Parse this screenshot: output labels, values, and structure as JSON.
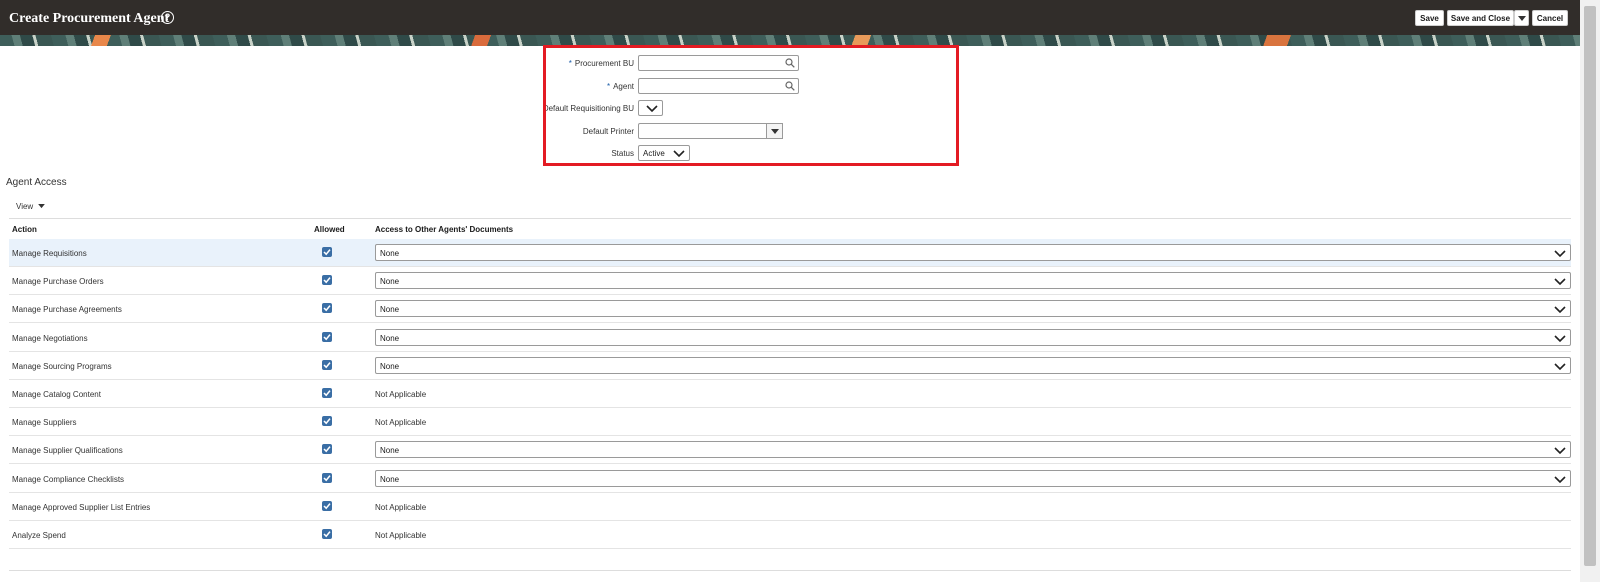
{
  "header": {
    "title": "Create Procurement Agent",
    "help_icon": "question-circle-icon",
    "buttons": {
      "save": "Save",
      "save_and_close": "Save and Close",
      "cancel": "Cancel"
    }
  },
  "form": {
    "procurement_bu": {
      "label": "Procurement BU",
      "required_marker": "*",
      "value": ""
    },
    "agent": {
      "label": "Agent",
      "required_marker": "*",
      "value": ""
    },
    "default_requisitioning_bu": {
      "label": "Default Requisitioning BU",
      "value": ""
    },
    "default_printer": {
      "label": "Default Printer",
      "value": ""
    },
    "status": {
      "label": "Status",
      "value": "Active"
    }
  },
  "agent_access": {
    "section_title": "Agent Access",
    "view_menu": "View",
    "columns": {
      "action": "Action",
      "allowed": "Allowed",
      "access": "Access to Other Agents' Documents"
    },
    "rows": [
      {
        "action": "Manage Requisitions",
        "allowed": true,
        "access": "None",
        "access_type": "select"
      },
      {
        "action": "Manage Purchase Orders",
        "allowed": true,
        "access": "None",
        "access_type": "select"
      },
      {
        "action": "Manage Purchase Agreements",
        "allowed": true,
        "access": "None",
        "access_type": "select"
      },
      {
        "action": "Manage Negotiations",
        "allowed": true,
        "access": "None",
        "access_type": "select"
      },
      {
        "action": "Manage Sourcing Programs",
        "allowed": true,
        "access": "None",
        "access_type": "select"
      },
      {
        "action": "Manage Catalog Content",
        "allowed": true,
        "access": "Not Applicable",
        "access_type": "text"
      },
      {
        "action": "Manage Suppliers",
        "allowed": true,
        "access": "Not Applicable",
        "access_type": "text"
      },
      {
        "action": "Manage Supplier Qualifications",
        "allowed": true,
        "access": "None",
        "access_type": "select"
      },
      {
        "action": "Manage Compliance Checklists",
        "allowed": true,
        "access": "None",
        "access_type": "select"
      },
      {
        "action": "Manage Approved Supplier List Entries",
        "allowed": true,
        "access": "Not Applicable",
        "access_type": "text"
      },
      {
        "action": "Analyze Spend",
        "allowed": true,
        "access": "Not Applicable",
        "access_type": "text"
      }
    ]
  },
  "colors": {
    "header_bg": "#312d2a",
    "highlight": "#e31b23",
    "checkbox": "#3a6ea5",
    "selected_row": "#e9f2fb"
  }
}
